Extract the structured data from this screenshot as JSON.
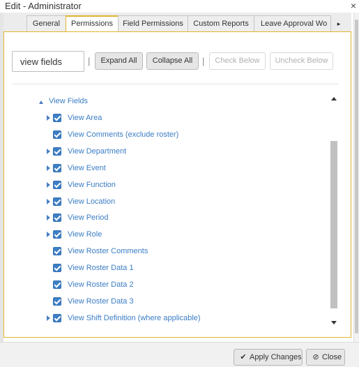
{
  "window": {
    "title": "Edit - Administrator",
    "close_glyph": "×"
  },
  "tabs": [
    {
      "label": "General",
      "active": false
    },
    {
      "label": "Permissions",
      "active": true
    },
    {
      "label": "Field Permissions",
      "active": false
    },
    {
      "label": "Custom Reports",
      "active": false
    },
    {
      "label": "Leave Approval Wo",
      "active": false
    }
  ],
  "tab_more_glyph": "▸",
  "toolbar": {
    "search_value": "view fields",
    "separator": "|",
    "expand_all": "Expand All",
    "collapse_all": "Collapse All",
    "check_below": "Check Below",
    "uncheck_below": "Uncheck Below"
  },
  "tree": {
    "root": {
      "label": "View Fields",
      "expanded": true
    },
    "items": [
      {
        "label": "View Area",
        "has_children": true,
        "checked": true
      },
      {
        "label": "View Comments (exclude roster)",
        "has_children": false,
        "checked": true
      },
      {
        "label": "View Department",
        "has_children": true,
        "checked": true
      },
      {
        "label": "View Event",
        "has_children": true,
        "checked": true
      },
      {
        "label": "View Function",
        "has_children": true,
        "checked": true
      },
      {
        "label": "View Location",
        "has_children": true,
        "checked": true
      },
      {
        "label": "View Period",
        "has_children": true,
        "checked": true
      },
      {
        "label": "View Role",
        "has_children": true,
        "checked": true
      },
      {
        "label": "View Roster Comments",
        "has_children": false,
        "checked": true
      },
      {
        "label": "View Roster Data 1",
        "has_children": false,
        "checked": true
      },
      {
        "label": "View Roster Data 2",
        "has_children": false,
        "checked": true
      },
      {
        "label": "View Roster Data 3",
        "has_children": false,
        "checked": true
      },
      {
        "label": "View Shift Definition (where applicable)",
        "has_children": true,
        "checked": true
      }
    ]
  },
  "footer": {
    "apply_label": "Apply Changes",
    "close_label": "Close",
    "apply_icon": "check-icon",
    "close_icon": "cancel-icon"
  },
  "colors": {
    "accent_border": "#e0b42d",
    "link_blue": "#3b7dc4",
    "checkbox_blue": "#3d7ec4"
  }
}
